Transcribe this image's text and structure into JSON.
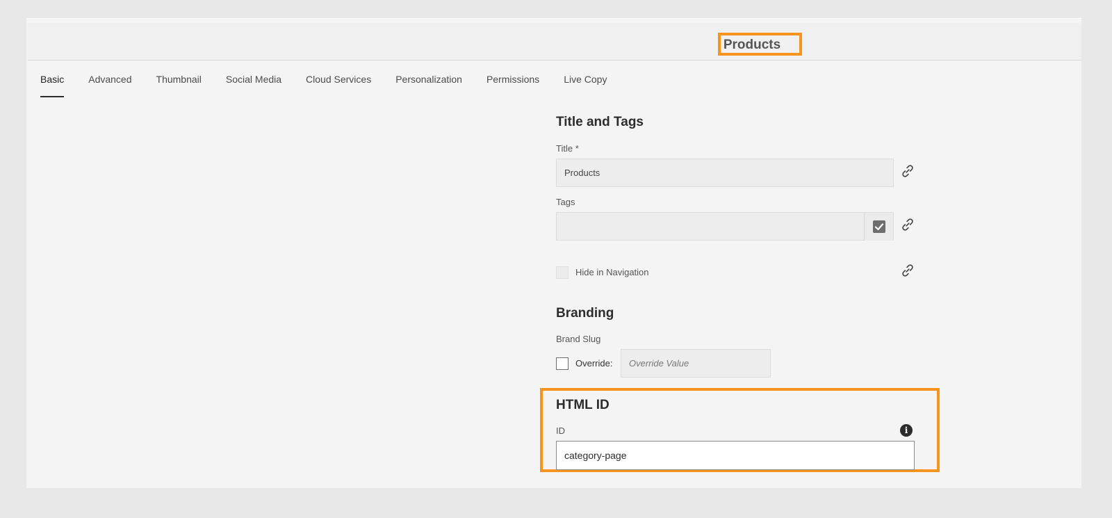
{
  "header": {
    "title": "Products"
  },
  "tabs": [
    {
      "label": "Basic",
      "active": true
    },
    {
      "label": "Advanced"
    },
    {
      "label": "Thumbnail"
    },
    {
      "label": "Social Media"
    },
    {
      "label": "Cloud Services"
    },
    {
      "label": "Personalization"
    },
    {
      "label": "Permissions"
    },
    {
      "label": "Live Copy"
    }
  ],
  "title_tags": {
    "heading": "Title and Tags",
    "title_label": "Title *",
    "title_value": "Products",
    "tags_label": "Tags",
    "tags_value": "",
    "hide_nav_label": "Hide in Navigation"
  },
  "branding": {
    "heading": "Branding",
    "brand_slug_label": "Brand Slug",
    "override_label": "Override:",
    "override_placeholder": "Override Value"
  },
  "html_id": {
    "heading": "HTML ID",
    "id_label": "ID",
    "id_value": "category-page"
  },
  "colors": {
    "highlight": "#f7941e",
    "background": "#f4f4f4"
  },
  "icons": {
    "link": "link-icon",
    "tags_picker": "checkbox-checked-icon",
    "info": "info-icon"
  }
}
